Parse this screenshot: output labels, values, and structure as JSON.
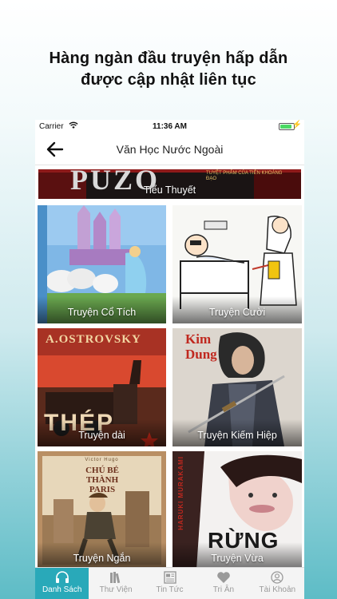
{
  "headline": {
    "line1": "Hàng ngàn đầu truyện hấp dẫn",
    "line2": "được cập nhật liên tục"
  },
  "status_bar": {
    "carrier": "Carrier",
    "time": "11:36 AM",
    "battery_level": 0.8
  },
  "nav": {
    "title": "Văn Học Nước Ngoài",
    "back_icon": "arrow-left-icon"
  },
  "top_banner": {
    "label": "Tiểu Thuyết",
    "cover_text": "PUZO",
    "cover_subtext": "TUYỆT PHẨM CỦA TIÊN KHOÁNG ĐẠO"
  },
  "categories": [
    {
      "label": "Truyện Cổ Tích"
    },
    {
      "label": "Truyện Cười"
    },
    {
      "label": "Truyện dài",
      "cover_text": "A.OSTROVSKY",
      "cover_title": "THÉP"
    },
    {
      "label": "Truyện Kiếm Hiệp",
      "cover_text": "Kim Dung"
    },
    {
      "label": "Truyện Ngắn",
      "cover_text": "CHÚ BÉ THÀNH PARIS",
      "cover_author": "Victor Hugo"
    },
    {
      "label": "Truyện Vừa",
      "cover_text": "RỪNG",
      "cover_author": "HARUKI MURAKAMI"
    }
  ],
  "tabs": [
    {
      "label": "Danh Sách",
      "icon": "headphones-icon",
      "active": true
    },
    {
      "label": "Thư Viện",
      "icon": "books-icon",
      "active": false
    },
    {
      "label": "Tin Tức",
      "icon": "newspaper-icon",
      "active": false
    },
    {
      "label": "Tri Ân",
      "icon": "heart-icon",
      "active": false
    },
    {
      "label": "Tài Khoản",
      "icon": "user-icon",
      "active": false
    }
  ],
  "colors": {
    "accent": "#29a9b9",
    "tab_inactive": "#9a9a9a"
  }
}
